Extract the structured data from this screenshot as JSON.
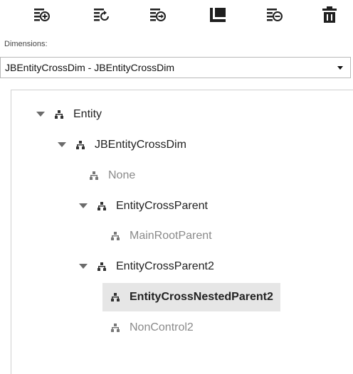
{
  "toolbar": {
    "buttons": [
      {
        "name": "add-node-icon"
      },
      {
        "name": "refresh-node-icon"
      },
      {
        "name": "insert-node-icon"
      },
      {
        "name": "collapse-all-icon"
      },
      {
        "name": "remove-node-icon"
      },
      {
        "name": "delete-icon"
      }
    ]
  },
  "dimensions": {
    "label": "Dimensions:",
    "selected": "JBEntityCrossDim - JBEntityCrossDim"
  },
  "tree": {
    "nodes": [
      {
        "label": "Entity",
        "expanded": true,
        "active": true,
        "selected": false
      },
      {
        "label": "JBEntityCrossDim",
        "expanded": true,
        "active": true,
        "selected": false
      },
      {
        "label": "None",
        "expanded": null,
        "active": false,
        "selected": false
      },
      {
        "label": "EntityCrossParent",
        "expanded": true,
        "active": true,
        "selected": false
      },
      {
        "label": "MainRootParent",
        "expanded": null,
        "active": false,
        "selected": false
      },
      {
        "label": "EntityCrossParent2",
        "expanded": true,
        "active": true,
        "selected": false
      },
      {
        "label": "EntityCrossNestedParent2",
        "expanded": null,
        "active": true,
        "selected": true
      },
      {
        "label": "NonControl2",
        "expanded": null,
        "active": false,
        "selected": false
      }
    ]
  },
  "colors": {
    "icon": "#1f1f1f",
    "selected_bg": "#e6e6e6",
    "inactive_text": "#8a8a8a"
  }
}
